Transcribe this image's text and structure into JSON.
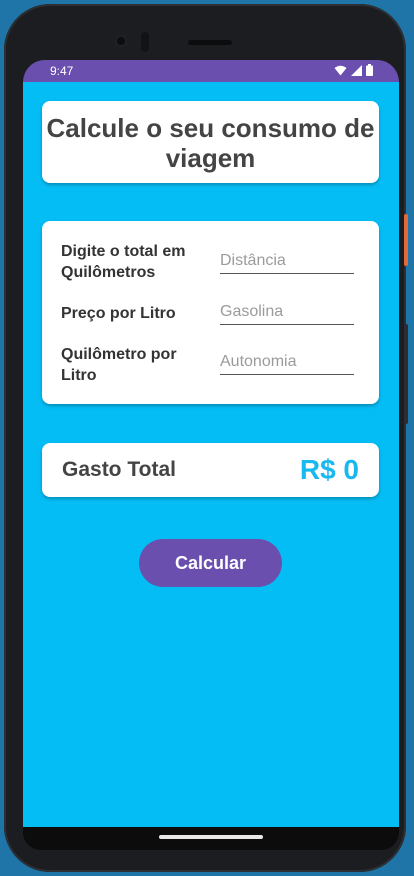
{
  "status_bar": {
    "time": "9:47"
  },
  "header": {
    "title_line1": "Calcule o seu consumo de",
    "title_line2": "viagem"
  },
  "form": {
    "fields": [
      {
        "label_line1": "Digite o total em",
        "label_line2": "Quilômetros",
        "placeholder": "Distância"
      },
      {
        "label_line1": "Preço por Litro",
        "label_line2": "",
        "placeholder": "Gasolina"
      },
      {
        "label_line1": "Quilômetro por",
        "label_line2": "Litro",
        "placeholder": "Autonomia"
      }
    ]
  },
  "result": {
    "label": "Gasto Total",
    "value": "R$ 0"
  },
  "actions": {
    "calculate_label": "Calcular"
  },
  "colors": {
    "accent": "#6a4fae",
    "background": "#05bdf5",
    "result_value": "#18b8f0"
  },
  "icons": [
    "wifi-icon",
    "cellular-signal-icon",
    "battery-icon"
  ]
}
